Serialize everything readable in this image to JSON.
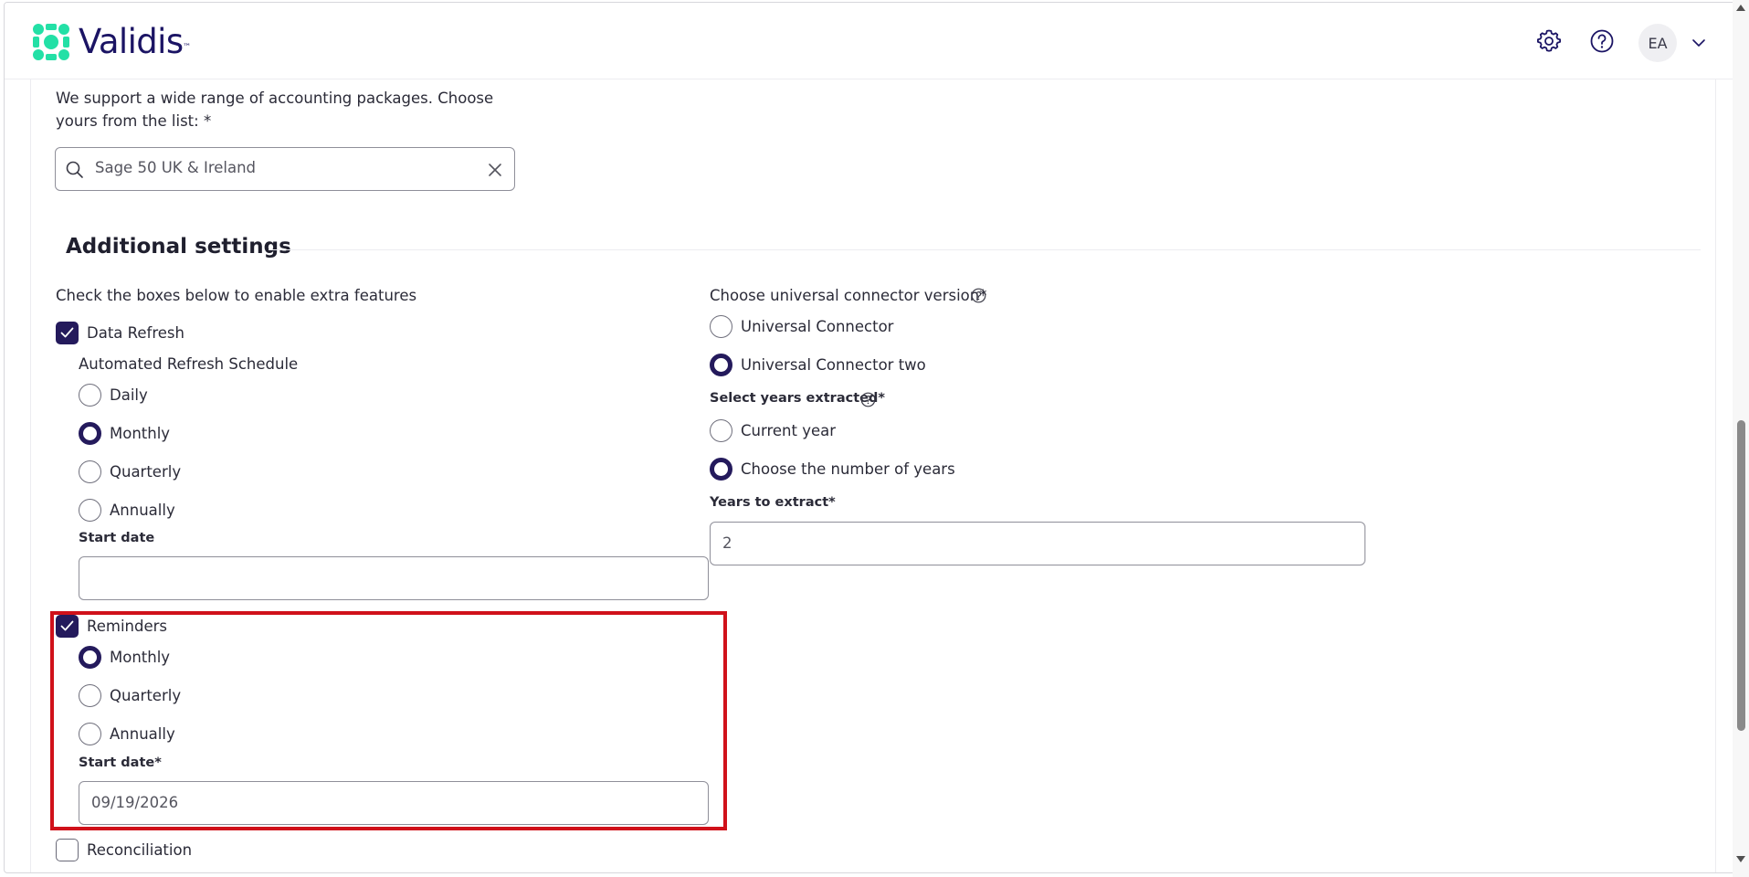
{
  "brand": {
    "name": "Validis",
    "tm": "™",
    "accent": "#1b1464",
    "logo_green": "#23e0a6"
  },
  "header": {
    "avatar_initials": "EA"
  },
  "package": {
    "intro": "We support a wide range of accounting packages. Choose yours from the list: *",
    "selected": "Sage 50 UK & Ireland"
  },
  "additional": {
    "title": "Additional settings",
    "left_intro": "Check the boxes below to enable extra features",
    "data_refresh": {
      "label": "Data Refresh",
      "checked": true,
      "schedule_label": "Automated Refresh Schedule",
      "options": [
        "Daily",
        "Monthly",
        "Quarterly",
        "Annually"
      ],
      "selected": "Monthly",
      "start_date_label": "Start date",
      "start_date_value": ""
    },
    "reminders": {
      "label": "Reminders",
      "checked": true,
      "options": [
        "Monthly",
        "Quarterly",
        "Annually"
      ],
      "selected": "Monthly",
      "start_date_label": "Start date*",
      "start_date_value": "09/19/2026"
    },
    "reconciliation": {
      "label": "Reconciliation",
      "checked": false
    },
    "connector": {
      "label": "Choose universal connector version*",
      "options": [
        "Universal Connector",
        "Universal Connector two"
      ],
      "selected": "Universal Connector two"
    },
    "years": {
      "label": "Select years extracted*",
      "options": [
        "Current year",
        "Choose the number of years"
      ],
      "selected": "Choose the number of years",
      "extract_label": "Years to extract*",
      "extract_value": "2"
    }
  },
  "colors": {
    "primary": "#241a5c",
    "highlight": "#d0111a"
  }
}
